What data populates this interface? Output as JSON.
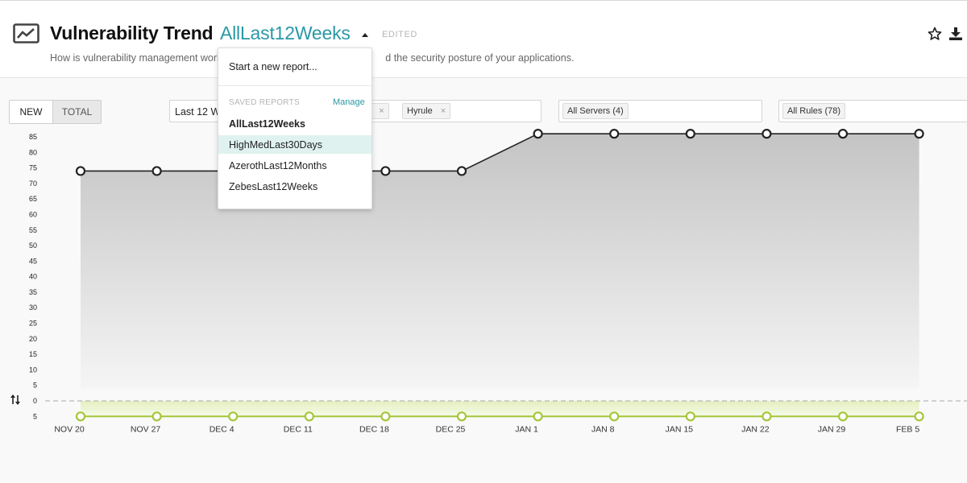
{
  "header": {
    "title": "Vulnerability Trend",
    "report_name": "AllLast12Weeks",
    "edited_label": "EDITED",
    "subtitle_left": "How is vulnerability management work",
    "subtitle_right": "d the security posture of your applications."
  },
  "toolbar": {
    "new_label": "NEW",
    "total_label": "TOTAL",
    "date_range_value": "Last 12 Weeks",
    "environment_chips": [
      {
        "label": "th"
      },
      {
        "label": "Hyrule"
      }
    ],
    "servers_chip": "All Servers (4)",
    "rules_chip": "All Rules (78)",
    "chip_remove_glyph": "×"
  },
  "dropdown": {
    "start_new": "Start a new report...",
    "saved_header": "SAVED REPORTS",
    "manage_label": "Manage",
    "items": [
      {
        "label": "AllLast12Weeks",
        "selected": true
      },
      {
        "label": "HighMedLast30Days",
        "highlighted": true
      },
      {
        "label": "AzerothLast12Months"
      },
      {
        "label": "ZebesLast12Weeks"
      }
    ]
  },
  "colors": {
    "accent": "#2a98a6",
    "total_line": "#222222",
    "new_line": "#a4c639",
    "highlight": "#dff2ef"
  },
  "icons": {
    "title_icon": "line-chart-icon",
    "favorite": "star-icon",
    "download": "download-icon",
    "sort_toggle": "sort-arrows-icon"
  },
  "chart_data": {
    "type": "area",
    "categories": [
      "NOV 20",
      "NOV 27",
      "DEC 4",
      "DEC 11",
      "DEC 18",
      "DEC 25",
      "JAN 1",
      "JAN 8",
      "JAN 15",
      "JAN 22",
      "JAN 29",
      "FEB 5"
    ],
    "yticks_positive": [
      "85",
      "80",
      "75",
      "70",
      "65",
      "60",
      "55",
      "50",
      "45",
      "40",
      "35",
      "30",
      "25",
      "20",
      "15",
      "10",
      "5",
      "0"
    ],
    "yticks_negative": [
      "5"
    ],
    "series": [
      {
        "values": [
          74,
          74,
          74,
          74,
          74,
          74,
          86,
          86,
          86,
          86,
          86,
          86
        ]
      },
      {
        "values": [
          -5,
          -5,
          -5,
          -5,
          -5,
          -5,
          -5,
          -5,
          -5,
          -5,
          -5,
          -5
        ]
      }
    ],
    "ylim": [
      -5,
      85
    ],
    "grid": false,
    "zero_line": "dashed"
  }
}
